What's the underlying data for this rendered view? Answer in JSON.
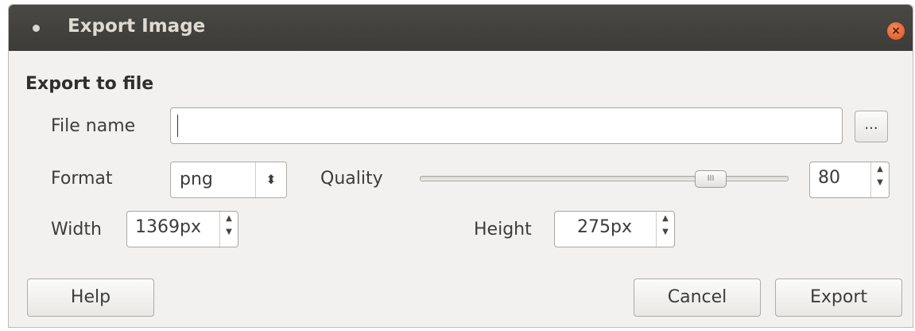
{
  "window": {
    "title": "Export Image",
    "close_icon": "×"
  },
  "section": {
    "title": "Export to file"
  },
  "file": {
    "label": "File name",
    "value": "",
    "browse_label": "..."
  },
  "format": {
    "label": "Format",
    "value": "png",
    "arrow": "⬍"
  },
  "quality": {
    "label": "Quality",
    "value": "80",
    "slider_value": 80,
    "slider_max": 100
  },
  "width": {
    "label": "Width",
    "value": "1369px"
  },
  "height": {
    "label": "Height",
    "value": "275px"
  },
  "buttons": {
    "help": "Help",
    "cancel": "Cancel",
    "export": "Export"
  },
  "colors": {
    "titlebar": "#3c3b37",
    "close": "#e0541e",
    "window_bg": "#f2f1f0"
  }
}
